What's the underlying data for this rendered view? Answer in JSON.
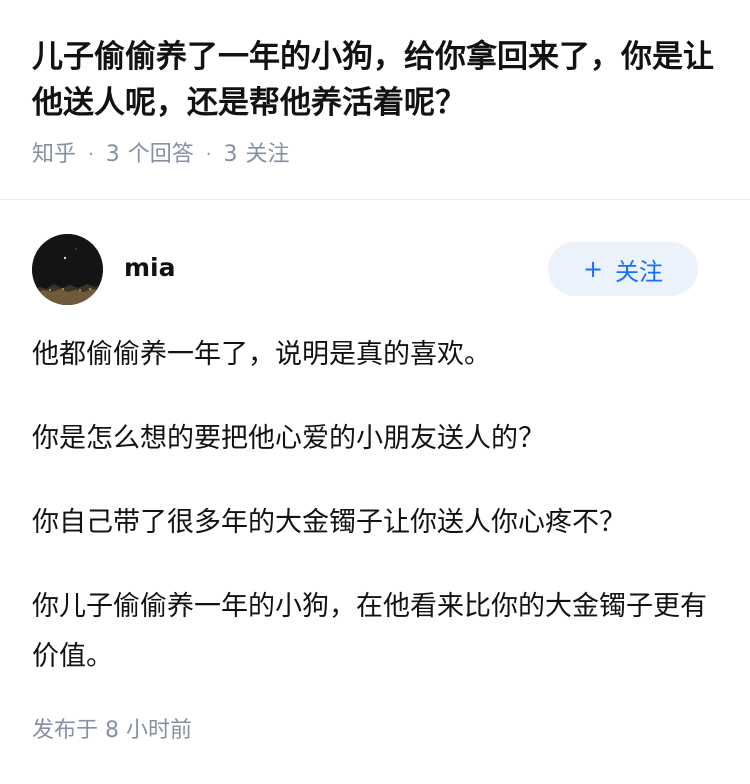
{
  "question": {
    "title": "儿子偷偷养了一年的小狗，给你拿回来了，你是让他送人呢，还是帮他养活着呢？",
    "site": "知乎",
    "answer_count": "3",
    "answer_label": "个回答",
    "follower_count": "3",
    "follower_label": "关注"
  },
  "answer": {
    "author_name": "mia",
    "follow_label": "关注",
    "follow_icon": "plus-icon",
    "paragraphs": [
      "他都偷偷养一年了，说明是真的喜欢。",
      "你是怎么想的要把他心爱的小朋友送人的？",
      "你自己带了很多年的大金镯子让你送人你心疼不？",
      "你儿子偷偷养一年的小狗，在他看来比你的大金镯子更有价值。"
    ],
    "time_text": "发布于 8 小时前"
  },
  "colors": {
    "accent": "#1772f6",
    "follow_bg": "#ebf2fc",
    "meta_gray": "#8590a6",
    "text": "#121212"
  }
}
